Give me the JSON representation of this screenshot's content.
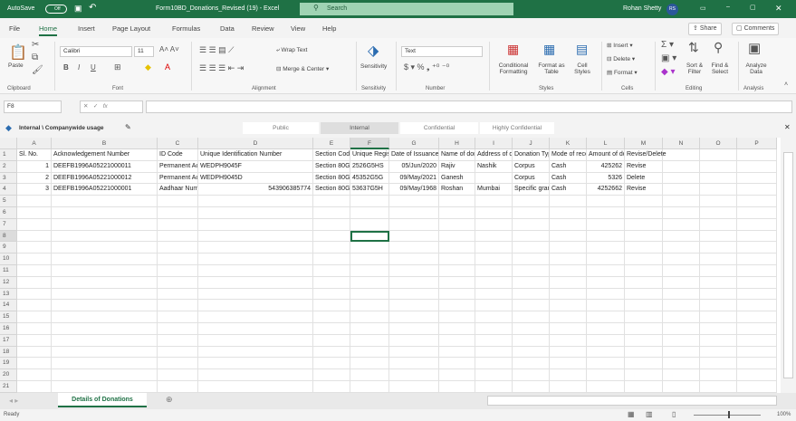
{
  "title": {
    "autosave": "AutoSave",
    "toggle": "Off",
    "filename": "Form10BD_Donations_Revised (19)  -  Excel",
    "search": "Search",
    "user": "Rohan Shetty",
    "initials": "RS"
  },
  "tabs": [
    "File",
    "Home",
    "Insert",
    "Page Layout",
    "Formulas",
    "Data",
    "Review",
    "View",
    "Help"
  ],
  "share": "Share",
  "comments": "Comments",
  "ribbon": {
    "paste": "Paste",
    "font": "Calibri",
    "size": "11",
    "wrap": "Wrap Text",
    "merge": "Merge & Center",
    "sensitivity": "Sensitivity",
    "numfmt": "Text",
    "cond": "Conditional Formatting",
    "fmt_table": "Format as Table",
    "cell_styles": "Cell Styles",
    "insert": "Insert",
    "delete": "Delete",
    "format": "Format",
    "sort": "Sort & Filter",
    "find": "Find & Select",
    "analyze": "Analyze Data",
    "groups": [
      "Clipboard",
      "Font",
      "Alignment",
      "Sensitivity",
      "Number",
      "Styles",
      "Cells",
      "Editing",
      "Analysis"
    ]
  },
  "namebox": "F8",
  "fx": "fx",
  "sensitivity_bar": {
    "label": "Internal \\ Companywide usage",
    "options": [
      "Public",
      "Internal",
      "Confidential",
      "Highly Confidential"
    ]
  },
  "columns": [
    "A",
    "B",
    "C",
    "D",
    "E",
    "F",
    "G",
    "H",
    "I",
    "J",
    "K",
    "L",
    "M",
    "N",
    "O",
    "P"
  ],
  "rows": [
    [
      "Sl. No.",
      "Acknowledgement Number",
      "ID Code",
      "Unique Identification Number",
      "Section Code",
      "Unique Registration Number",
      "Date of Issuance",
      "Name of donor",
      "Address of donor",
      "Donation Type",
      "Mode of receipt",
      "Amount of donation",
      "Revise/Delete",
      "",
      "",
      ""
    ],
    [
      "1",
      "DEEFB1996A05221000011",
      "Permanent Account Number",
      "WEDPH9045F",
      "",
      "Section 80G",
      "2526G5HS",
      "05/Jun/2020",
      "Rajiv",
      "Nashik",
      "Corpus",
      "Cash",
      "425262",
      "Revise"
    ],
    [
      "2",
      "DEEFB1996A05221000012",
      "Permanent Account Number",
      "WEDPH9045D",
      "",
      "Section 80G",
      "45352G5G",
      "09/May/2021",
      "Ganesh",
      "",
      "Corpus",
      "Cash",
      "5326",
      "Delete"
    ],
    [
      "3",
      "DEEFB1996A05221000001",
      "Aadhaar Number",
      "543906385774",
      "",
      "Section 80G",
      "53637G5H",
      "09/May/1968",
      "Roshan",
      "Mumbai",
      "Specific grant",
      "Cash",
      "4252662",
      "Revise"
    ]
  ],
  "selected_cell": "F8",
  "sheet_tab": "Details of Donations",
  "status": {
    "ready": "Ready",
    "zoom": "100%"
  }
}
